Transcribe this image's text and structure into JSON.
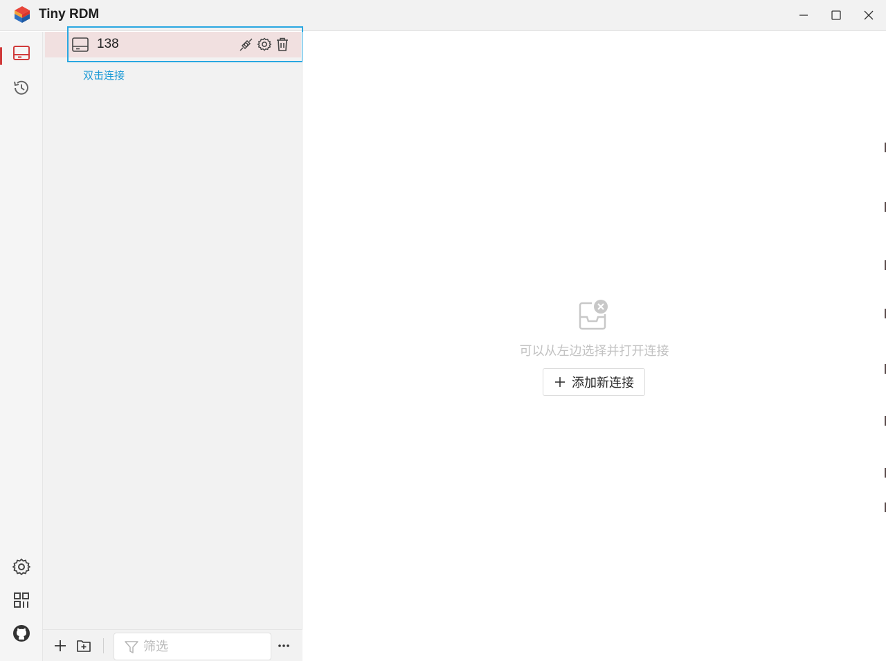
{
  "app": {
    "title": "Tiny RDM"
  },
  "window_controls": {
    "minimize": "minimize-icon",
    "maximize": "maximize-icon",
    "close": "close-icon"
  },
  "rail": {
    "items": [
      {
        "name": "server-icon",
        "active": true
      },
      {
        "name": "history-icon",
        "active": false
      }
    ],
    "bottom_items": [
      {
        "name": "settings-icon"
      },
      {
        "name": "apps-grid-icon"
      },
      {
        "name": "github-icon"
      }
    ],
    "accent_color": "#d03a3a"
  },
  "connections": {
    "items": [
      {
        "name": "138",
        "icon": "server-icon",
        "actions": [
          "disconnect-icon",
          "settings-icon",
          "trash-icon"
        ]
      }
    ],
    "tooltip": "双击连接",
    "highlight_color": "#f1e0e0",
    "focus_color": "#29a7e1"
  },
  "footer": {
    "add_connection_icon": "plus-icon",
    "add_group_icon": "folder-plus-icon",
    "filter_placeholder": "筛选",
    "more_icon": "more-icon"
  },
  "main": {
    "empty_icon": "empty-inbox-icon",
    "empty_text": "可以从左边选择并打开连接",
    "add_button_label": "添加新连接"
  }
}
